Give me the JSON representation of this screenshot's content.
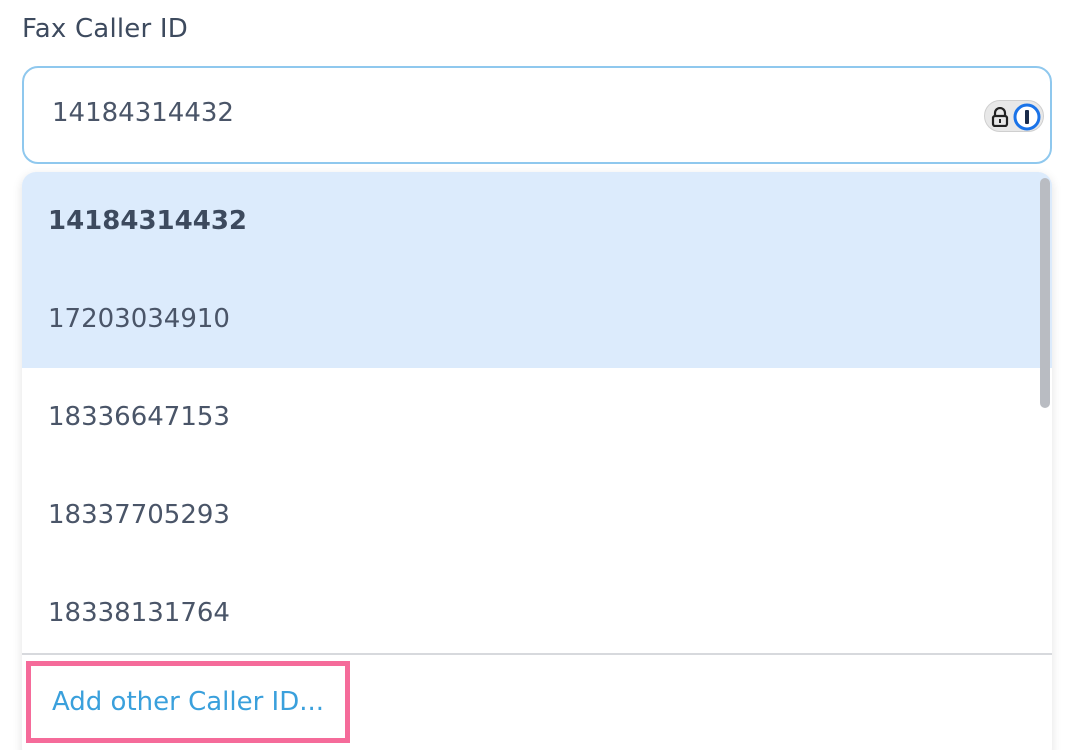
{
  "field": {
    "label": "Fax Caller ID",
    "value": "14184314432"
  },
  "password_manager": {
    "lock_icon": "lock-icon",
    "brand_icon": "password-manager-icon",
    "brand_color": "#1a73e8"
  },
  "dropdown": {
    "options": [
      {
        "label": "14184314432",
        "selected": true,
        "highlighted": true
      },
      {
        "label": "17203034910",
        "selected": false,
        "highlighted": true
      },
      {
        "label": "18336647153",
        "selected": false,
        "highlighted": false
      },
      {
        "label": "18337705293",
        "selected": false,
        "highlighted": false
      },
      {
        "label": "18338131764",
        "selected": false,
        "highlighted": false
      }
    ],
    "add_link_label": "Add other Caller ID...",
    "highlight_color": "#dcebfc",
    "link_color": "#3aa0dc",
    "annotation_border_color": "#f56b9a"
  }
}
